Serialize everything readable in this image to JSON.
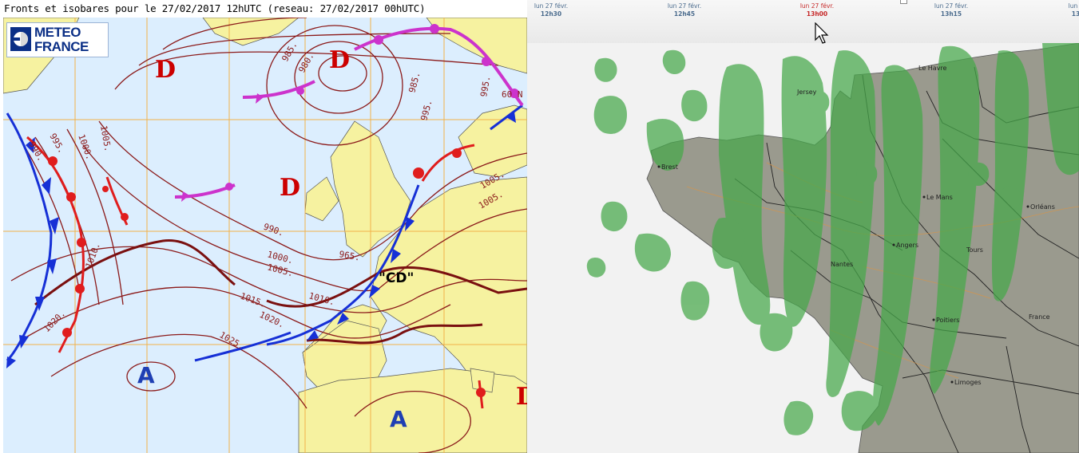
{
  "left_panel": {
    "title": "Fronts et isobares pour le 27/02/2017 12hUTC (reseau: 27/02/2017 00hUTC)",
    "logo": {
      "line1": "METEO",
      "line2": "FRANCE",
      "icon": "meteo-france-logo"
    },
    "isobar_labels": [
      "990.",
      "995.",
      "1000.",
      "1005.",
      "1005.",
      "1010.",
      "980.",
      "985.",
      "985.",
      "990.",
      "995.",
      "995.",
      "1000.",
      "1005.",
      "1010.",
      "1015.",
      "1020.",
      "1020.",
      "1025.",
      "965.",
      "1005.",
      "60 N"
    ],
    "pressure_centers": [
      {
        "kind": "D",
        "color": "#cc0000"
      },
      {
        "kind": "D",
        "color": "#cc0000"
      },
      {
        "kind": "D",
        "color": "#cc0000"
      },
      {
        "kind": "D",
        "color": "#cc0000"
      },
      {
        "kind": "A",
        "color": "#1f3fb3"
      },
      {
        "kind": "A",
        "color": "#1f3fb3"
      }
    ],
    "annotation": "\"CD\"",
    "colors": {
      "sea": "#dceefe",
      "land": "#f6f2a0",
      "isobar": "#8b1a1a",
      "cold_front": "#1630d6",
      "warm_front": "#e01d1d",
      "occlusion": "#cc33cc",
      "grid": "#f2b24a"
    }
  },
  "right_panel": {
    "timeline": [
      {
        "day": "lun 27 févr.",
        "time": "12h30",
        "current": false
      },
      {
        "day": "lun 27 févr.",
        "time": "12h45",
        "current": false
      },
      {
        "day": "lun 27 févr.",
        "time": "13h00",
        "current": true
      },
      {
        "day": "lun 27 févr.",
        "time": "13h15",
        "current": false
      },
      {
        "day": "lun 2",
        "time": "13",
        "current": false
      }
    ],
    "cities": [
      "Brest",
      "Le Mans",
      "Angers",
      "Poitiers",
      "Limoges",
      "Orléans",
      "France",
      "Le Havre",
      "Jersey",
      "Nantes",
      "Tours"
    ],
    "colors": {
      "background": "#f2f2f2",
      "land": "#9a9a8e",
      "rain": "#46a84a",
      "current_time": "#c62828",
      "timeline_text": "#4a6b8d"
    }
  }
}
